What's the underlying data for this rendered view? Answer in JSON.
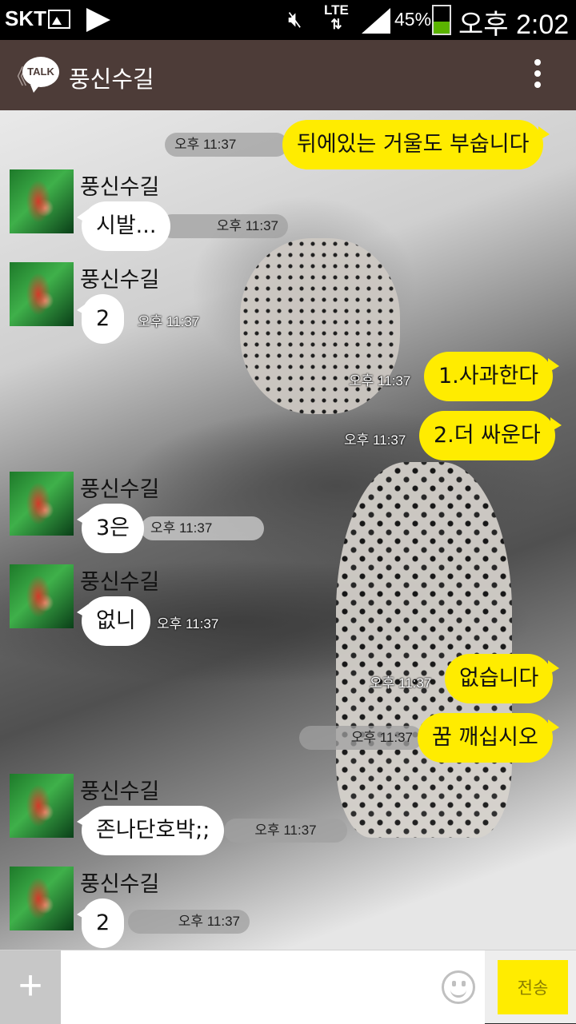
{
  "status_bar": {
    "carrier": "SKT",
    "network": "LTE",
    "battery_percent": "45%",
    "time": "오후 2:02",
    "icons": [
      "photo-icon",
      "play-icon",
      "mute-icon",
      "signal-icon",
      "battery-icon"
    ]
  },
  "header": {
    "back": "《",
    "logo": "TALK",
    "title": "풍신수길"
  },
  "messages": [
    {
      "side": "out",
      "text": "뒤에있는 거울도 부숩니다",
      "time": "오후 11:37"
    },
    {
      "side": "in",
      "sender": "풍신수길",
      "text": "시발...",
      "time": "오후 11:37"
    },
    {
      "side": "in",
      "sender": "풍신수길",
      "text": "2",
      "time": "오후 11:37"
    },
    {
      "side": "out",
      "text": "1.사과한다",
      "time": "오후 11:37"
    },
    {
      "side": "out",
      "text": "2.더 싸운다",
      "time": "오후 11:37"
    },
    {
      "side": "in",
      "sender": "풍신수길",
      "text": "3은",
      "time": "오후 11:37"
    },
    {
      "side": "in",
      "sender": "풍신수길",
      "text": "없니",
      "time": "오후 11:37"
    },
    {
      "side": "out",
      "text": "없습니다",
      "time": "오후 11:37"
    },
    {
      "side": "out",
      "text": "꿈 깨십시오",
      "time": "오후 11:37"
    },
    {
      "side": "in",
      "sender": "풍신수길",
      "text": "존나단호박;;",
      "time": "오후 11:37"
    },
    {
      "side": "in",
      "sender": "풍신수길",
      "text": "2",
      "time": "오후 11:37"
    }
  ],
  "input_bar": {
    "plus": "+",
    "text_value": "",
    "send_label": "전송"
  },
  "colors": {
    "header_bg": "#4d3c38",
    "outgoing_bubble": "#ffec00",
    "incoming_bubble": "#ffffff"
  }
}
